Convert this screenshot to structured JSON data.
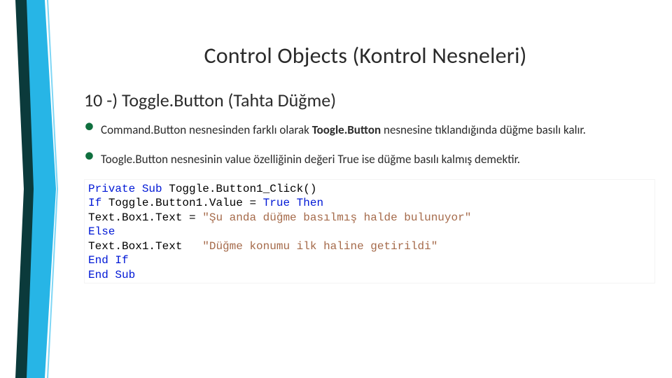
{
  "header": {
    "title": "Control Objects (Kontrol Nesneleri)"
  },
  "section": {
    "subtitle": "10 -) Toggle.Button (Tahta Düğme)"
  },
  "bullets": [
    {
      "pre": "Command.Button nesnesinden farklı olarak ",
      "bold": "Toogle.Button",
      "post": " nesnesine tıklandığında düğme basılı kalır."
    },
    {
      "pre": "Toogle.Button nesnesinin value özelliğinin değeri True ise düğme basılı kalmış demektir.",
      "bold": "",
      "post": ""
    }
  ],
  "code": {
    "line1_kw": "Private Sub ",
    "line1_rest": "Toggle.Button1_Click()",
    "line2_kw1": "If ",
    "line2_mid": "Toggle.Button1.Value = ",
    "line2_kw2": "True Then",
    "line3_lhs": "Text.Box1.Text = ",
    "line3_str": "\"Şu anda düğme basılmış halde bulunuyor\"",
    "line4_kw": "Else",
    "line5_lhs": "Text.Box1.Text   ",
    "line5_str": "\"Düğme konumu ilk haline getirildi\"",
    "line6_kw": "End If",
    "line7_kw": "End Sub"
  }
}
